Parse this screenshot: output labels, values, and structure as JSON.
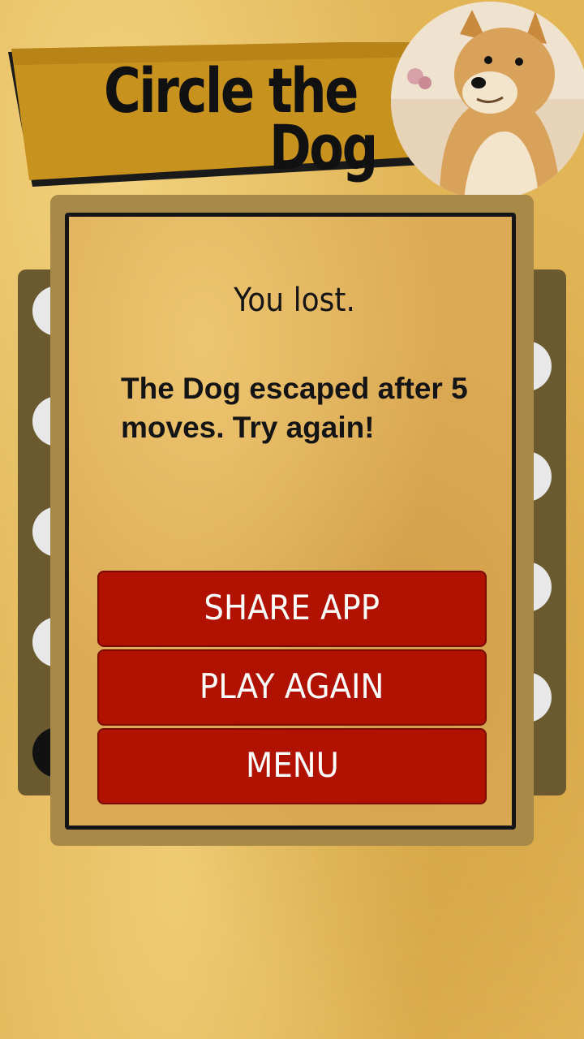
{
  "header": {
    "title_line1": "Circle the",
    "title_line2": "Dog",
    "banner_color": "#c8921e"
  },
  "dialog": {
    "status": "You lost.",
    "message": "The Dog escaped after 5 moves. Try again!",
    "buttons": {
      "share": "SHARE APP",
      "play_again": "PLAY AGAIN",
      "menu": "MENU"
    },
    "button_color": "#b11200"
  }
}
